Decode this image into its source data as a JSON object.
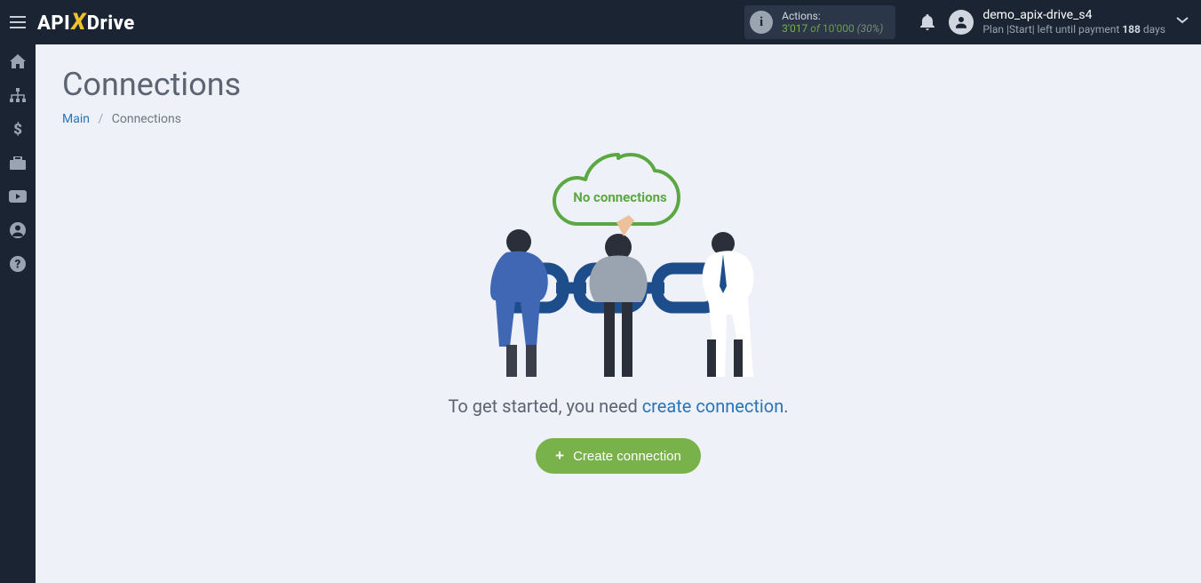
{
  "logo": {
    "part1": "API",
    "x": "X",
    "part2": "Drive"
  },
  "actions": {
    "label": "Actions:",
    "used": "3'017",
    "of": "of",
    "total": "10'000",
    "pct": "(30%)"
  },
  "user": {
    "name": "demo_apix-drive_s4",
    "plan_prefix": "Plan |Start| left until payment ",
    "plan_days": "188",
    "plan_suffix": " days"
  },
  "sidebar": {
    "items": [
      {
        "name": "home-icon"
      },
      {
        "name": "connections-icon"
      },
      {
        "name": "billing-icon"
      },
      {
        "name": "briefcase-icon"
      },
      {
        "name": "youtube-icon"
      },
      {
        "name": "account-icon"
      },
      {
        "name": "help-icon"
      }
    ]
  },
  "page": {
    "title": "Connections",
    "breadcrumb_main": "Main",
    "breadcrumb_current": "Connections"
  },
  "empty": {
    "cloud_text": "No connections",
    "started_prefix": "To get started, you need ",
    "started_link": "create connection",
    "started_suffix": ".",
    "button_label": "Create connection"
  }
}
